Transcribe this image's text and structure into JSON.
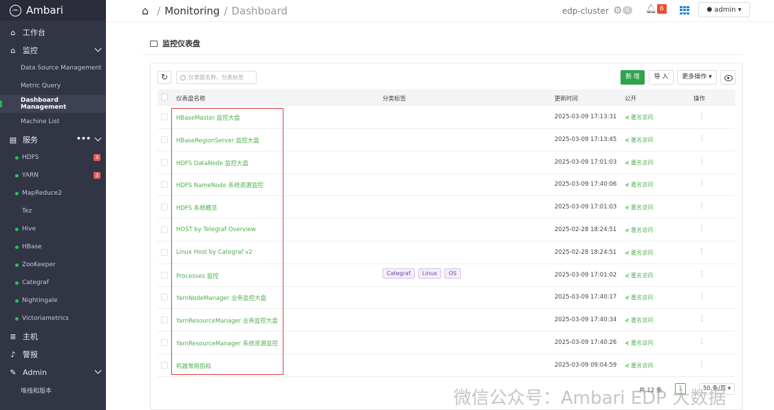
{
  "sidebar": {
    "brand": "Ambari",
    "workbench": "工作台",
    "monitor": "监控",
    "monitor_items": [
      "Data Source Management",
      "Metric Query",
      "Dashboard Management",
      "Machine List"
    ],
    "services": "服务",
    "services_more": "•••",
    "service_items": [
      {
        "label": "HDFS",
        "dot": true,
        "badge": "3"
      },
      {
        "label": "YARN",
        "dot": true,
        "badge": "3"
      },
      {
        "label": "MapReduce2",
        "dot": true,
        "badge": ""
      },
      {
        "label": "Tez",
        "dot": false,
        "badge": ""
      },
      {
        "label": "Hive",
        "dot": true,
        "badge": ""
      },
      {
        "label": "HBase",
        "dot": true,
        "badge": ""
      },
      {
        "label": "ZooKeeper",
        "dot": true,
        "badge": ""
      },
      {
        "label": "Categraf",
        "dot": true,
        "badge": ""
      },
      {
        "label": "Nightingale",
        "dot": true,
        "badge": ""
      },
      {
        "label": "Victoriametrics",
        "dot": true,
        "badge": ""
      }
    ],
    "hosts": "主机",
    "alerts": "警报",
    "admin": "Admin",
    "stack_version": "堆栈和版本"
  },
  "topbar": {
    "crumb_1": "Monitoring",
    "crumb_sep": "/",
    "crumb_2": "Dashboard",
    "cluster": "edp-cluster",
    "gear_badge": "0",
    "alert_badge": "6",
    "user": "admin ▾"
  },
  "panel": {
    "title": "监控仪表盘",
    "search_placeholder": "仪表盘名称、分类标签",
    "new_label": "新 增",
    "import_label": "导 入",
    "more_label": "更多操作 ▾"
  },
  "table": {
    "headers": {
      "name": "仪表盘名称",
      "tags": "分类标签",
      "updated": "更新时间",
      "public": "公开",
      "ops": "操作"
    },
    "rows": [
      {
        "name": "HBaseMaster 监控大盘",
        "tags": [],
        "time": "2025-03-09 17:13:31",
        "public": "匿名访问"
      },
      {
        "name": "HBaseRegionServer 监控大盘",
        "tags": [],
        "time": "2025-03-09 17:13:45",
        "public": "匿名访问"
      },
      {
        "name": "HDFS DataNode 监控大盘",
        "tags": [],
        "time": "2025-03-09 17:01:03",
        "public": "匿名访问"
      },
      {
        "name": "HDFS NameNode 系统资源监控",
        "tags": [],
        "time": "2025-03-09 17:40:06",
        "public": "匿名访问"
      },
      {
        "name": "HDFS 系统概览",
        "tags": [],
        "time": "2025-03-09 17:01:03",
        "public": "匿名访问"
      },
      {
        "name": "HOST by Telegraf Overview",
        "tags": [],
        "time": "2025-02-28 18:24:51",
        "public": "匿名访问"
      },
      {
        "name": "Linux Host by Categraf v2",
        "tags": [],
        "time": "2025-02-28 18:24:51",
        "public": "匿名访问"
      },
      {
        "name": "Processes 监控",
        "tags": [
          "Categraf",
          "Linux",
          "OS"
        ],
        "time": "2025-03-09 17:01:02",
        "public": "匿名访问"
      },
      {
        "name": "YarnNodeManager 业务监控大盘",
        "tags": [],
        "time": "2025-03-09 17:40:17",
        "public": "匿名访问"
      },
      {
        "name": "YarnResourceManager 业务监控大盘",
        "tags": [],
        "time": "2025-03-09 17:40:34",
        "public": "匿名访问"
      },
      {
        "name": "YarnResourceManager 系统资源监控",
        "tags": [],
        "time": "2025-03-09 17:40:26",
        "public": "匿名访问"
      },
      {
        "name": "机器常用指标",
        "tags": [],
        "time": "2025-03-09 09:04:59",
        "public": "匿名访问"
      }
    ]
  },
  "pagination": {
    "total": "共 12 条",
    "page": "1",
    "page_size": "50 条/页 ▾"
  },
  "watermark": "微信公众号：Ambari EDP 大数据"
}
